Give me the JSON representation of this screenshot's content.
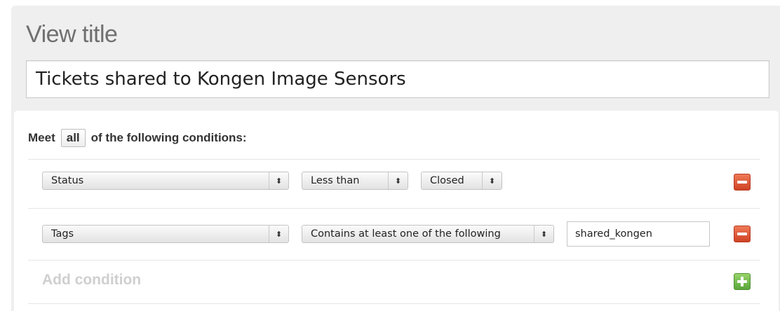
{
  "view_title": {
    "label": "View title",
    "value": "Tickets shared to Kongen Image Sensors"
  },
  "conditions": {
    "meet_prefix": "Meet",
    "match_mode": "all",
    "meet_suffix": "of the following conditions:",
    "rows": [
      {
        "field": "Status",
        "operator": "Less than",
        "value": "Closed"
      },
      {
        "field": "Tags",
        "operator": "Contains at least one of the following",
        "value": "shared_kongen"
      }
    ],
    "add_label": "Add condition"
  },
  "icons": {
    "select_arrows": "⬍",
    "remove": "remove-icon",
    "add": "add-icon"
  },
  "colors": {
    "remove_button": "#d9502e",
    "add_button": "#6fb648"
  }
}
